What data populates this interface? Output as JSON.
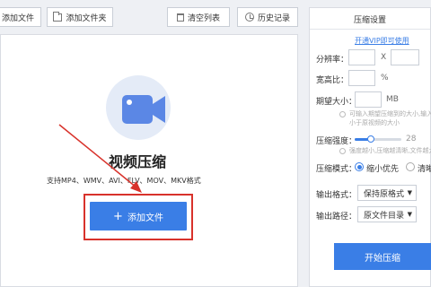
{
  "toolbar": {
    "add_file": "添加文件",
    "add_folder": "添加文件夹",
    "clear_list": "清空列表",
    "history": "历史记录"
  },
  "main": {
    "title": "视频压缩",
    "formats": "支持MP4、WMV、AVI、FLV、MOV、MKV格式",
    "add_button_label": "添加文件",
    "plus": "+"
  },
  "settings": {
    "title": "压缩设置",
    "vip_link": "开通VIP即可使用",
    "resolution_label": "分辨率：",
    "resolution_x": "X",
    "aspect_label": "宽高比：",
    "aspect_unit": "%",
    "size_label": "期望大小：",
    "size_unit": "MB",
    "size_hint1": "可输入期望压缩到的大小,输入值",
    "size_hint2": "小于原视频的大小",
    "strength_label": "压缩强度：",
    "strength_value": "28",
    "strength_fraction": 0.35,
    "strength_hint": "强度越小,压缩越清晰,文件越大",
    "mode_label": "压缩模式：",
    "mode_small": "缩小优先",
    "mode_clear": "清晰优先",
    "format_label": "输出格式：",
    "format_value": "保持原格式",
    "path_label": "输出路径：",
    "path_value": "原文件目录",
    "start_button": "开始压缩"
  },
  "colors": {
    "accent": "#3a7ee6",
    "annotation_red": "#d8322b",
    "icon_bg": "#e4ebf7"
  }
}
